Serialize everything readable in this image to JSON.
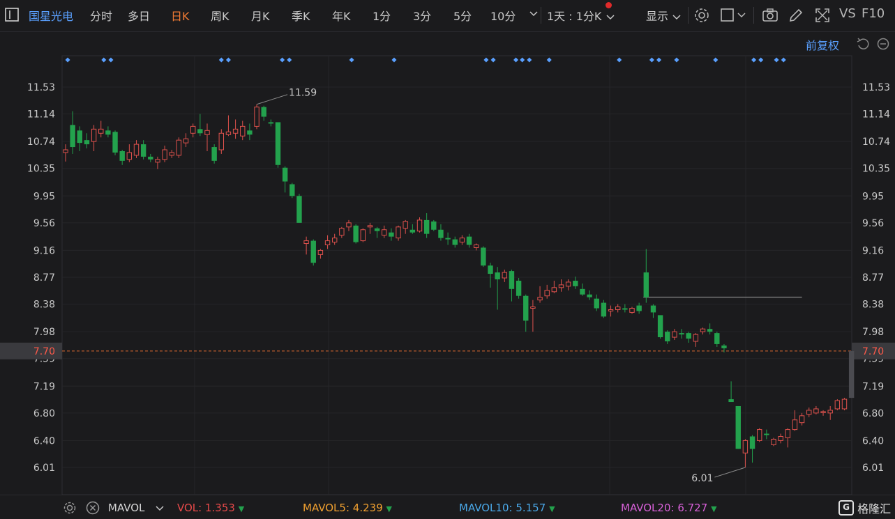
{
  "toolbar": {
    "stock_name": "国星光电",
    "tabs": [
      "分时",
      "多日",
      "日K",
      "周K",
      "月K",
      "季K",
      "年K",
      "1分",
      "3分",
      "5分",
      "10分"
    ],
    "active_tab": "日K",
    "period_select": "1天 : 1分K",
    "display_label": "显示",
    "vs_label": "VS",
    "f10_label": "F10",
    "adjust_label": "前复权"
  },
  "chart_data": {
    "type": "candlestick",
    "y_ticks": [
      "11.53",
      "11.14",
      "10.74",
      "10.35",
      "9.95",
      "9.56",
      "9.16",
      "8.77",
      "8.38",
      "7.98",
      "7.59",
      "7.19",
      "6.80",
      "6.40",
      "6.01"
    ],
    "high_label": "11.59",
    "low_label": "6.01",
    "current_price": "7.70",
    "up_color": "#e0524d",
    "down_color": "#23a24d",
    "candles": [
      [
        10.58,
        10.62,
        10.7,
        10.45
      ],
      [
        10.98,
        10.66,
        11.18,
        10.56
      ],
      [
        10.9,
        10.72,
        10.96,
        10.6
      ],
      [
        10.76,
        10.7,
        10.86,
        10.64
      ],
      [
        10.74,
        10.92,
        10.98,
        10.6
      ],
      [
        10.86,
        10.92,
        11.04,
        10.8
      ],
      [
        10.9,
        10.84,
        10.96,
        10.8
      ],
      [
        10.88,
        10.58,
        10.9,
        10.54
      ],
      [
        10.6,
        10.46,
        10.62,
        10.4
      ],
      [
        10.48,
        10.58,
        10.7,
        10.44
      ],
      [
        10.54,
        10.7,
        10.76,
        10.5
      ],
      [
        10.7,
        10.52,
        10.76,
        10.48
      ],
      [
        10.52,
        10.48,
        10.56,
        10.44
      ],
      [
        10.44,
        10.48,
        10.52,
        10.34
      ],
      [
        10.48,
        10.62,
        10.68,
        10.44
      ],
      [
        10.54,
        10.58,
        10.62,
        10.5
      ],
      [
        10.54,
        10.76,
        10.8,
        10.5
      ],
      [
        10.72,
        10.78,
        10.86,
        10.66
      ],
      [
        10.86,
        10.96,
        11.0,
        10.8
      ],
      [
        10.92,
        10.86,
        11.14,
        10.82
      ],
      [
        10.84,
        10.9,
        11.0,
        10.6
      ],
      [
        10.66,
        10.46,
        10.7,
        10.42
      ],
      [
        10.62,
        10.86,
        10.92,
        10.56
      ],
      [
        10.84,
        10.88,
        11.12,
        10.82
      ],
      [
        10.86,
        10.92,
        11.06,
        10.78
      ],
      [
        10.82,
        10.96,
        11.04,
        10.76
      ],
      [
        10.9,
        10.84,
        11.0,
        10.76
      ],
      [
        10.96,
        11.24,
        11.28,
        10.92
      ],
      [
        11.24,
        11.1,
        11.26,
        11.04
      ],
      [
        11.02,
        11.0,
        11.06,
        10.96
      ],
      [
        11.02,
        10.4,
        11.02,
        10.36
      ],
      [
        10.36,
        10.16,
        10.38,
        10.0
      ],
      [
        10.12,
        9.95,
        10.14,
        9.92
      ],
      [
        9.95,
        9.56,
        9.98,
        9.56
      ],
      [
        9.26,
        9.3,
        9.36,
        9.1
      ],
      [
        9.3,
        8.98,
        9.32,
        8.94
      ],
      [
        9.1,
        9.16,
        9.18,
        9.04
      ],
      [
        9.24,
        9.3,
        9.38,
        9.18
      ],
      [
        9.28,
        9.34,
        9.4,
        9.24
      ],
      [
        9.38,
        9.48,
        9.5,
        9.34
      ],
      [
        9.5,
        9.56,
        9.6,
        9.44
      ],
      [
        9.52,
        9.28,
        9.54,
        9.26
      ],
      [
        9.3,
        9.46,
        9.48,
        9.28
      ],
      [
        9.5,
        9.52,
        9.56,
        9.4
      ],
      [
        9.48,
        9.44,
        9.5,
        9.34
      ],
      [
        9.38,
        9.46,
        9.52,
        9.34
      ],
      [
        9.42,
        9.36,
        9.48,
        9.3
      ],
      [
        9.34,
        9.5,
        9.52,
        9.3
      ],
      [
        9.48,
        9.58,
        9.6,
        9.4
      ],
      [
        9.46,
        9.42,
        9.54,
        9.4
      ],
      [
        9.44,
        9.6,
        9.64,
        9.42
      ],
      [
        9.6,
        9.4,
        9.7,
        9.34
      ],
      [
        9.58,
        9.46,
        9.6,
        9.44
      ],
      [
        9.46,
        9.34,
        9.54,
        9.3
      ],
      [
        9.34,
        9.32,
        9.42,
        9.24
      ],
      [
        9.32,
        9.24,
        9.36,
        9.2
      ],
      [
        9.28,
        9.34,
        9.38,
        9.24
      ],
      [
        9.36,
        9.24,
        9.4,
        9.2
      ],
      [
        9.2,
        9.24,
        9.26,
        9.16
      ],
      [
        9.2,
        8.94,
        9.22,
        8.92
      ],
      [
        8.94,
        8.82,
        8.98,
        8.62
      ],
      [
        8.84,
        8.74,
        8.92,
        8.3
      ],
      [
        8.76,
        8.84,
        8.88,
        8.7
      ],
      [
        8.86,
        8.6,
        8.88,
        8.42
      ],
      [
        8.72,
        8.5,
        8.76,
        8.46
      ],
      [
        8.5,
        8.14,
        8.52,
        7.98
      ],
      [
        8.32,
        8.34,
        8.44,
        7.98
      ],
      [
        8.44,
        8.48,
        8.64,
        8.4
      ],
      [
        8.5,
        8.58,
        8.66,
        8.46
      ],
      [
        8.56,
        8.62,
        8.72,
        8.54
      ],
      [
        8.62,
        8.66,
        8.74,
        8.56
      ],
      [
        8.64,
        8.7,
        8.74,
        8.58
      ],
      [
        8.72,
        8.64,
        8.78,
        8.6
      ],
      [
        8.6,
        8.52,
        8.68,
        8.5
      ],
      [
        8.52,
        8.48,
        8.58,
        8.44
      ],
      [
        8.46,
        8.32,
        8.52,
        8.28
      ],
      [
        8.4,
        8.2,
        8.44,
        8.18
      ],
      [
        8.28,
        8.3,
        8.36,
        8.2
      ],
      [
        8.3,
        8.34,
        8.38,
        8.26
      ],
      [
        8.32,
        8.3,
        8.38,
        8.26
      ],
      [
        8.26,
        8.32,
        8.34,
        8.24
      ],
      [
        8.36,
        8.28,
        8.4,
        8.24
      ],
      [
        8.84,
        8.48,
        9.18,
        8.4
      ],
      [
        8.36,
        8.26,
        8.38,
        8.18
      ],
      [
        8.22,
        7.9,
        8.22,
        7.88
      ],
      [
        7.98,
        7.84,
        8.0,
        7.8
      ],
      [
        7.9,
        7.98,
        8.02,
        7.86
      ],
      [
        7.96,
        7.94,
        8.02,
        7.88
      ],
      [
        7.96,
        7.88,
        7.98,
        7.82
      ],
      [
        7.84,
        7.94,
        7.96,
        7.76
      ],
      [
        7.98,
        8.02,
        8.04,
        7.94
      ],
      [
        8.02,
        7.98,
        8.1,
        7.94
      ],
      [
        7.96,
        7.8,
        7.98,
        7.76
      ],
      [
        7.78,
        7.74,
        7.8,
        7.68
      ],
      [
        7.0,
        6.96,
        7.26,
        6.96
      ],
      [
        6.9,
        6.28,
        6.9,
        6.28
      ],
      [
        6.22,
        6.4,
        6.42,
        6.01
      ],
      [
        6.46,
        6.28,
        6.48,
        6.08
      ],
      [
        6.4,
        6.56,
        6.58,
        6.38
      ],
      [
        6.5,
        6.48,
        6.56,
        6.42
      ],
      [
        6.34,
        6.42,
        6.44,
        6.32
      ],
      [
        6.4,
        6.46,
        6.5,
        6.36
      ],
      [
        6.44,
        6.56,
        6.58,
        6.3
      ],
      [
        6.56,
        6.7,
        6.84,
        6.54
      ],
      [
        6.66,
        6.76,
        6.8,
        6.62
      ],
      [
        6.78,
        6.84,
        6.88,
        6.74
      ],
      [
        6.8,
        6.86,
        6.9,
        6.78
      ],
      [
        6.82,
        6.82,
        6.84,
        6.76
      ],
      [
        6.8,
        6.84,
        6.9,
        6.7
      ],
      [
        6.86,
        6.98,
        7.0,
        6.84
      ],
      [
        6.86,
        7.0,
        7.02,
        6.84
      ],
      [
        7.02,
        7.7,
        7.7,
        7.02
      ]
    ],
    "event_markers": [
      0.3,
      5.4,
      6.4,
      22,
      23,
      30.6,
      31.6,
      40.4,
      46.4,
      59.4,
      60.4,
      63.6,
      64.5,
      65.5,
      68.3,
      78.2,
      82.8,
      83.8,
      86.3,
      91.8,
      97.2,
      98.2,
      100.4,
      101.4
    ],
    "resistance_line": {
      "from_index": 81.6,
      "to_index": 104,
      "price": 8.48
    }
  },
  "volume_bar": {
    "label": "MAVOL",
    "vol_label": "VOL:",
    "vol_value": "1.353",
    "mavol5_label": "MAVOL5:",
    "mavol5_value": "4.239",
    "mavol10_label": "MAVOL10:",
    "mavol10_value": "5.157",
    "mavol20_label": "MAVOL20:",
    "mavol20_value": "6.727",
    "brand": "格隆汇"
  }
}
